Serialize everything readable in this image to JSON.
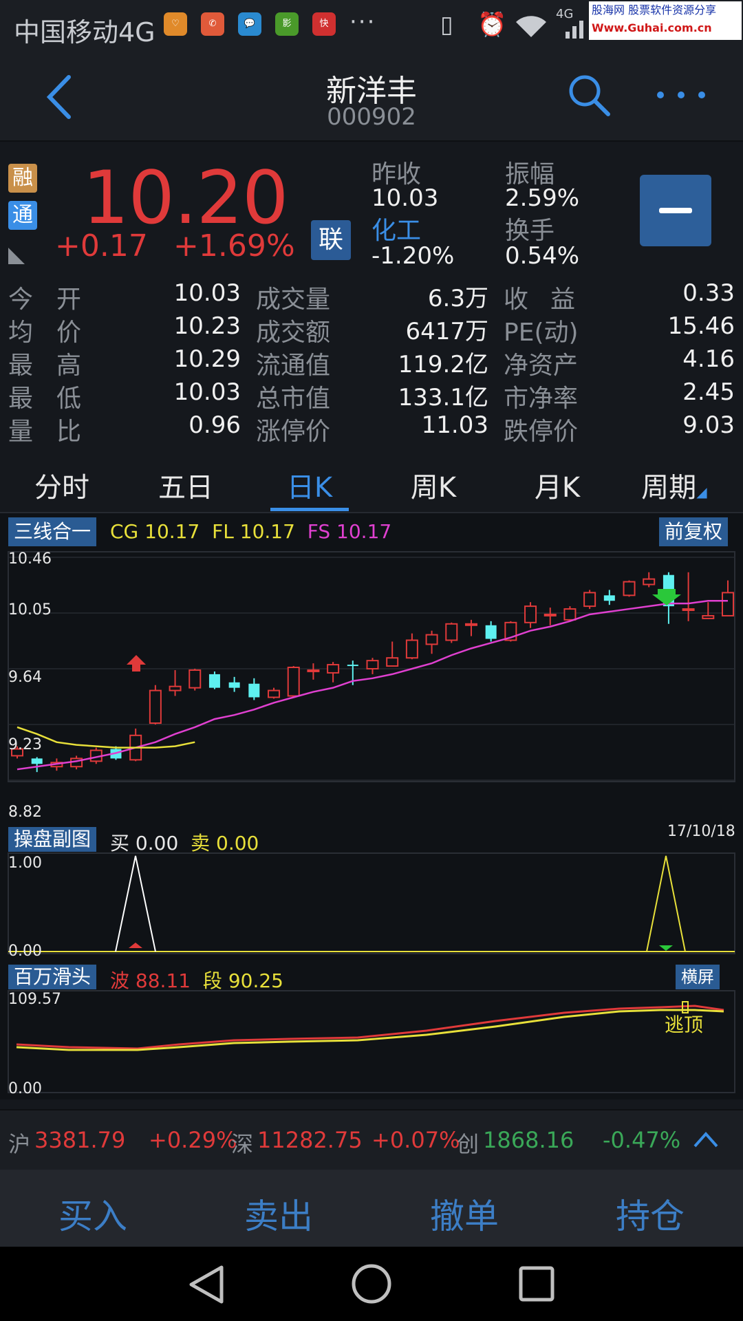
{
  "status_bar": {
    "carrier": "中国移动4G",
    "network": "4G",
    "dots": "···",
    "apps": [
      {
        "icon": "health-app-icon",
        "color": "#e08a2a",
        "text": "♡"
      },
      {
        "icon": "missed-call-icon",
        "color": "#e05a3a",
        "text": "✆"
      },
      {
        "icon": "message-app-icon",
        "color": "#2a8ad0",
        "text": "…"
      },
      {
        "icon": "video-app-icon",
        "color": "#4a9a2a",
        "text": "影视"
      },
      {
        "icon": "news-app-icon",
        "color": "#d03030",
        "text": "快报"
      }
    ],
    "watermark_line1": "股海网 股票软件资源分享",
    "watermark_line2": "Www.Guhai.com.cn"
  },
  "header": {
    "title": "新洋丰",
    "code": "000902"
  },
  "quote": {
    "badge_rong": "融",
    "badge_tong": "通",
    "price": "10.20",
    "change": "+0.17",
    "change_pct": "+1.69%",
    "lian": "联",
    "prev_close_label": "昨收",
    "prev_close": "10.03",
    "amplitude_label": "振幅",
    "amplitude": "2.59%",
    "sector_label": "化工",
    "sector_change": "-1.20%",
    "turnover_label": "换手",
    "turnover": "0.54%",
    "rows": [
      {
        "l1": "今",
        "l2": "开",
        "v1": "10.03",
        "m": "成交量",
        "v2": "6.3万",
        "r1": "收",
        "r2": "益",
        "v3": "0.33"
      },
      {
        "l1": "均",
        "l2": "价",
        "v1": "10.23",
        "m": "成交额",
        "v2": "6417万",
        "r1": "PE(动)",
        "r2": "",
        "v3": "15.46"
      },
      {
        "l1": "最",
        "l2": "高",
        "v1": "10.29",
        "m": "流通值",
        "v2": "119.2亿",
        "r1": "净资产",
        "r2": "",
        "v3": "4.16"
      },
      {
        "l1": "最",
        "l2": "低",
        "v1": "10.03",
        "m": "总市值",
        "v2": "133.1亿",
        "r1": "市净率",
        "r2": "",
        "v3": "2.45"
      },
      {
        "l1": "量",
        "l2": "比",
        "v1": "0.96",
        "m": "涨停价",
        "v2": "11.03",
        "r1": "跌停价",
        "r2": "",
        "v3": "9.03"
      }
    ]
  },
  "tabs": [
    "分时",
    "五日",
    "日K",
    "周K",
    "月K",
    "周期"
  ],
  "main_chart": {
    "tag": "三线合一",
    "cg_label": "CG",
    "cg": "10.17",
    "fl_label": "FL",
    "fl": "10.17",
    "fs_label": "FS",
    "fs": "10.17",
    "adjust_button": "前复权",
    "y_labels": [
      "10.46",
      "10.05",
      "9.64",
      "9.23",
      "8.82"
    ]
  },
  "sub_chart1": {
    "tag": "操盘副图",
    "buy_label": "买",
    "buy": "0.00",
    "sell_label": "卖",
    "sell": "0.00",
    "date": "17/10/18",
    "y_top": "1.00",
    "y_bottom": "0.00"
  },
  "sub_chart2": {
    "tag": "百万滑头",
    "wave_label": "波",
    "wave": "88.11",
    "seg_label": "段",
    "seg": "90.25",
    "landscape_button": "横屏",
    "y_top": "109.57",
    "y_bottom": "0.00",
    "annotation": "逃顶"
  },
  "chart_data": {
    "type": "candlestick",
    "ylim": [
      8.82,
      10.46
    ],
    "y_ticks": [
      10.46,
      10.05,
      9.64,
      9.23,
      8.82
    ],
    "candles": [
      {
        "o": 9.0,
        "c": 9.05,
        "h": 9.07,
        "l": 8.98
      },
      {
        "o": 8.98,
        "c": 8.94,
        "h": 8.99,
        "l": 8.88
      },
      {
        "o": 8.92,
        "c": 8.95,
        "h": 8.98,
        "l": 8.89
      },
      {
        "o": 8.92,
        "c": 8.98,
        "h": 9.0,
        "l": 8.9
      },
      {
        "o": 8.96,
        "c": 9.04,
        "h": 9.06,
        "l": 8.94
      },
      {
        "o": 9.05,
        "c": 8.98,
        "h": 9.07,
        "l": 8.97
      },
      {
        "o": 8.97,
        "c": 9.15,
        "h": 9.2,
        "l": 8.96
      },
      {
        "o": 9.24,
        "c": 9.48,
        "h": 9.52,
        "l": 9.23
      },
      {
        "o": 9.48,
        "c": 9.51,
        "h": 9.63,
        "l": 9.44
      },
      {
        "o": 9.5,
        "c": 9.63,
        "h": 9.64,
        "l": 9.48
      },
      {
        "o": 9.6,
        "c": 9.5,
        "h": 9.62,
        "l": 9.49
      },
      {
        "o": 9.54,
        "c": 9.5,
        "h": 9.58,
        "l": 9.47
      },
      {
        "o": 9.53,
        "c": 9.43,
        "h": 9.57,
        "l": 9.41
      },
      {
        "o": 9.43,
        "c": 9.48,
        "h": 9.5,
        "l": 9.42
      },
      {
        "o": 9.44,
        "c": 9.65,
        "h": 9.66,
        "l": 9.44
      },
      {
        "o": 9.62,
        "c": 9.63,
        "h": 9.68,
        "l": 9.56
      },
      {
        "o": 9.61,
        "c": 9.67,
        "h": 9.69,
        "l": 9.54
      },
      {
        "o": 9.67,
        "c": 9.66,
        "h": 9.7,
        "l": 9.52
      },
      {
        "o": 9.64,
        "c": 9.7,
        "h": 9.72,
        "l": 9.6
      },
      {
        "o": 9.66,
        "c": 9.72,
        "h": 9.84,
        "l": 9.66
      },
      {
        "o": 9.72,
        "c": 9.85,
        "h": 9.9,
        "l": 9.71
      },
      {
        "o": 9.82,
        "c": 9.89,
        "h": 9.92,
        "l": 9.75
      },
      {
        "o": 9.85,
        "c": 9.97,
        "h": 9.98,
        "l": 9.83
      },
      {
        "o": 9.96,
        "c": 9.97,
        "h": 10.0,
        "l": 9.88
      },
      {
        "o": 9.96,
        "c": 9.86,
        "h": 9.99,
        "l": 9.84
      },
      {
        "o": 9.85,
        "c": 9.98,
        "h": 9.99,
        "l": 9.84
      },
      {
        "o": 9.98,
        "c": 10.1,
        "h": 10.13,
        "l": 9.94
      },
      {
        "o": 10.03,
        "c": 10.04,
        "h": 10.09,
        "l": 9.96
      },
      {
        "o": 10.0,
        "c": 10.08,
        "h": 10.1,
        "l": 9.99
      },
      {
        "o": 10.1,
        "c": 10.2,
        "h": 10.22,
        "l": 10.08
      },
      {
        "o": 10.18,
        "c": 10.14,
        "h": 10.22,
        "l": 10.11
      },
      {
        "o": 10.18,
        "c": 10.28,
        "h": 10.29,
        "l": 10.17
      },
      {
        "o": 10.26,
        "c": 10.3,
        "h": 10.35,
        "l": 10.24
      },
      {
        "o": 10.33,
        "c": 10.1,
        "h": 10.35,
        "l": 9.97
      },
      {
        "o": 10.08,
        "c": 10.08,
        "h": 10.35,
        "l": 9.99
      },
      {
        "o": 10.01,
        "c": 10.03,
        "h": 10.13,
        "l": 10.01
      },
      {
        "o": 10.03,
        "c": 10.2,
        "h": 10.29,
        "l": 10.03
      }
    ],
    "ma_pink": [
      8.9,
      8.92,
      8.94,
      8.96,
      8.99,
      9.02,
      9.06,
      9.1,
      9.16,
      9.21,
      9.27,
      9.3,
      9.34,
      9.39,
      9.43,
      9.47,
      9.5,
      9.55,
      9.57,
      9.6,
      9.64,
      9.68,
      9.74,
      9.79,
      9.83,
      9.87,
      9.92,
      9.95,
      9.99,
      10.04,
      10.06,
      10.08,
      10.1,
      10.12,
      10.12,
      10.14,
      10.14
    ],
    "ma_yellow": [
      9.21,
      9.16,
      9.1,
      9.08,
      9.07,
      9.06,
      9.06,
      9.06,
      9.07,
      9.1
    ]
  },
  "index_bar": {
    "sh_label": "沪",
    "sh_value": "3381.79",
    "sh_change": "+0.29%",
    "sz_label": "深",
    "sz_value": "11282.75",
    "sz_change": "+0.07%",
    "cy_label": "创",
    "cy_value": "1868.16",
    "cy_change": "-0.47%"
  },
  "actions": [
    "买入",
    "卖出",
    "撤单",
    "持仓"
  ],
  "colors": {
    "up": "#e03a3a",
    "down": "#5ef0f0",
    "accent": "#3a8ee6",
    "ma_pink": "#e040d0",
    "ma_yellow": "#e8e03a",
    "green_index": "#3aa858"
  }
}
